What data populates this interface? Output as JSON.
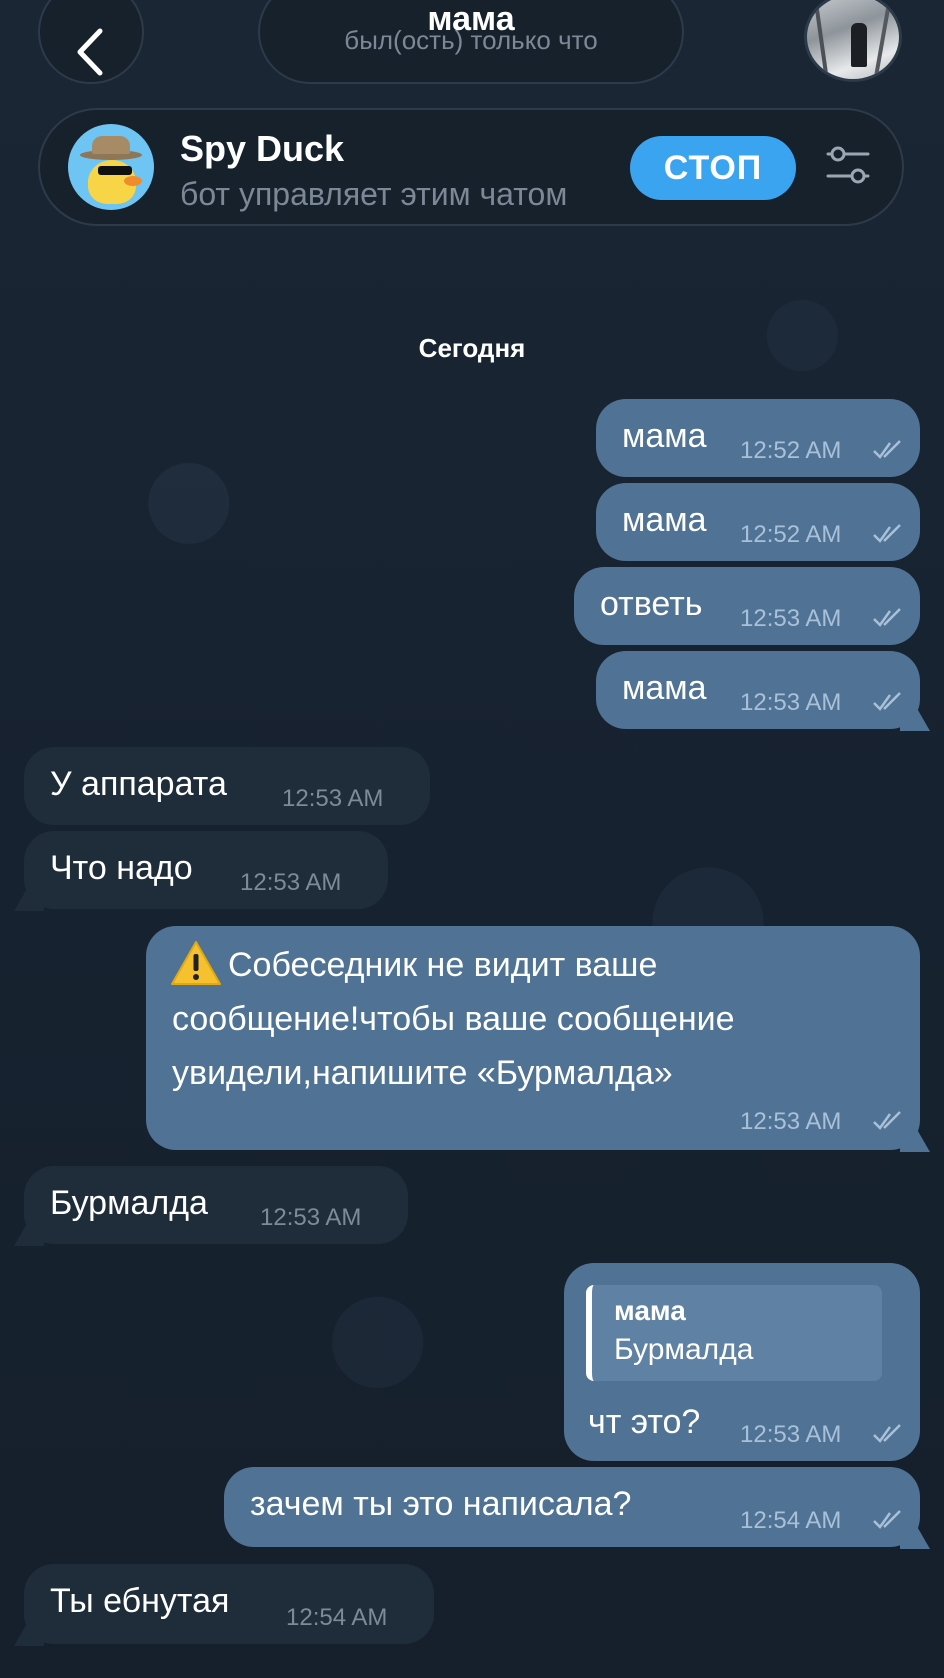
{
  "header": {
    "contact_name": "мама",
    "status": "был(ость) только что"
  },
  "bot_bar": {
    "bot_name": "Spy Duck",
    "subtitle": "бот управляет этим чатом",
    "stop_label": "СТОП"
  },
  "date_separator": "Сегодня",
  "messages": [
    {
      "dir": "out",
      "text": "мама",
      "time": "12:52 AM"
    },
    {
      "dir": "out",
      "text": "мама",
      "time": "12:52 AM"
    },
    {
      "dir": "out",
      "text": "ответь",
      "time": "12:53 AM"
    },
    {
      "dir": "out",
      "text": "мама",
      "time": "12:53 AM"
    },
    {
      "dir": "in",
      "text": "У аппарата",
      "time": "12:53 AM"
    },
    {
      "dir": "in",
      "text": "Что надо",
      "time": "12:53 AM"
    },
    {
      "dir": "out",
      "lines": [
        "Собеседник не видит ваше",
        "сообщение!чтобы ваше сообщение",
        "увидели,напишите «Бурмалда»"
      ],
      "time": "12:53 AM"
    },
    {
      "dir": "in",
      "text": "Бурмалда",
      "time": "12:53 AM"
    },
    {
      "dir": "out",
      "reply_name": "мама",
      "reply_text": "Бурмалда",
      "text": "чт это?",
      "time": "12:53 AM"
    },
    {
      "dir": "out",
      "text": "зачем ты это написала?",
      "time": "12:54 AM"
    },
    {
      "dir": "in",
      "text": "Ты ебнутая",
      "time": "12:54 AM"
    }
  ],
  "icons": {
    "back": "chevron-left-icon",
    "settings": "sliders-icon",
    "read": "double-check-icon",
    "warning": "warning-icon"
  },
  "colors": {
    "background": "#16222f",
    "outgoing_bubble": "#4f7295",
    "incoming_bubble": "#1f2c3a",
    "stop_button": "#3aa4f0"
  }
}
